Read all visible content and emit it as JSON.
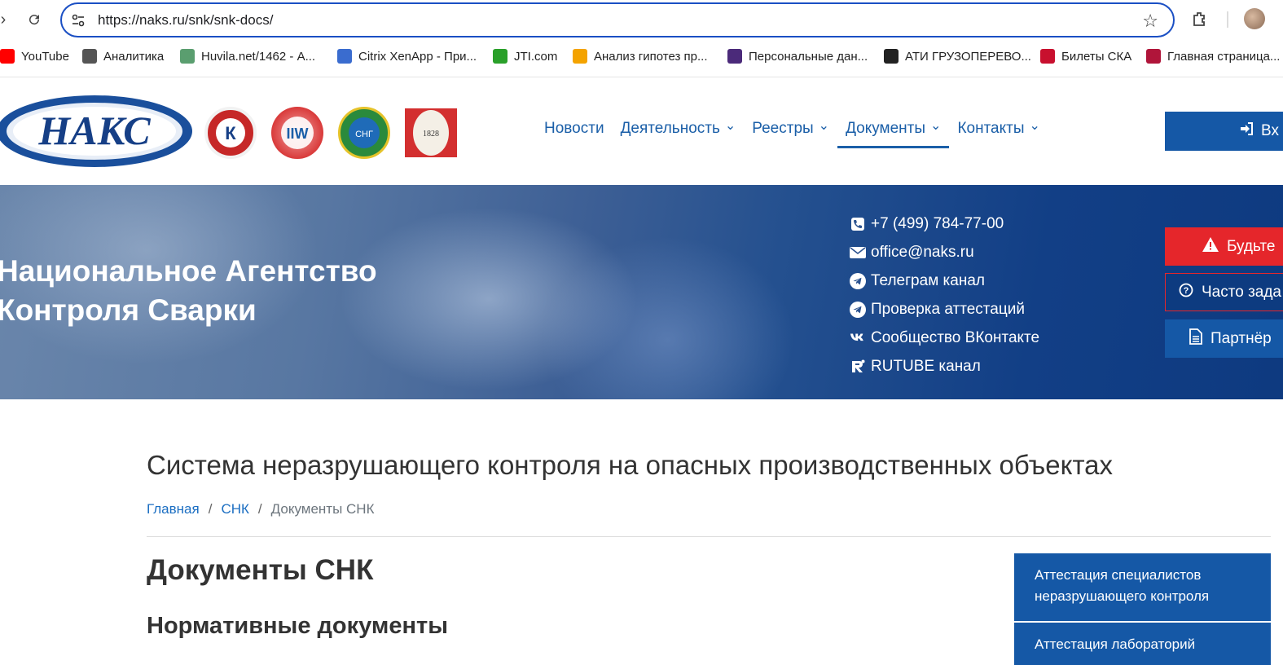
{
  "browser": {
    "url": "https://naks.ru/snk/snk-docs/",
    "bookmarks": [
      {
        "label": "YouTube",
        "icon": "youtube-icon",
        "color": "#ff0000"
      },
      {
        "label": "Аналитика",
        "icon": "facebook-icon",
        "color": "#555555"
      },
      {
        "label": "Huvila.net/1462 - А...",
        "icon": "huvila-icon",
        "color": "#5a9e6f"
      },
      {
        "label": "Citrix XenApp - При...",
        "icon": "citrix-icon",
        "color": "#3a6ccf"
      },
      {
        "label": "JTI.com",
        "icon": "jti-icon",
        "color": "#2aa02a"
      },
      {
        "label": "Анализ гипотез пр...",
        "icon": "hypothesis-icon",
        "color": "#f4a300"
      },
      {
        "label": "Персональные дан...",
        "icon": "personal-data-icon",
        "color": "#4b2a7a"
      },
      {
        "label": "АТИ ГРУЗОПЕРЕВО...",
        "icon": "ati-icon",
        "color": "#222222"
      },
      {
        "label": "Билеты СКА",
        "icon": "ska-icon",
        "color": "#c8102e"
      },
      {
        "label": "Главная страница...",
        "icon": "home-page-icon",
        "color": "#b0153a"
      }
    ]
  },
  "header": {
    "logo_text": "НАКС",
    "menu": [
      {
        "label": "Новости",
        "has_dropdown": false
      },
      {
        "label": "Деятельность",
        "has_dropdown": true
      },
      {
        "label": "Реестры",
        "has_dropdown": true
      },
      {
        "label": "Документы",
        "has_dropdown": true,
        "active": true
      },
      {
        "label": "Контакты",
        "has_dropdown": true
      }
    ],
    "login_label": "Вх"
  },
  "hero": {
    "title_line1": "Национальное Агентство",
    "title_line2": "Контроля Сварки",
    "contacts": [
      {
        "icon": "phone-icon",
        "text": "+7 (499) 784-77-00"
      },
      {
        "icon": "envelope-icon",
        "text": "office@naks.ru"
      },
      {
        "icon": "telegram-icon",
        "text": "Телеграм канал"
      },
      {
        "icon": "telegram-icon",
        "text": "Проверка аттестаций"
      },
      {
        "icon": "vk-icon",
        "text": "Сообщество ВКонтакте"
      },
      {
        "icon": "rutube-icon",
        "text": "RUTUBE канал"
      }
    ],
    "side_buttons": {
      "warning": "Будьте",
      "faq": "Часто зада",
      "partners": "Партнёр"
    }
  },
  "content": {
    "page_title": "Система неразрушающего контроля на опасных производственных объектах",
    "breadcrumb": {
      "home": "Главная",
      "section": "СНК",
      "current": "Документы СНК"
    },
    "heading": "Документы СНК",
    "subheading": "Нормативные документы",
    "side_nav": [
      "Аттестация специалистов неразрушающего контроля",
      "Аттестация лабораторий"
    ]
  }
}
